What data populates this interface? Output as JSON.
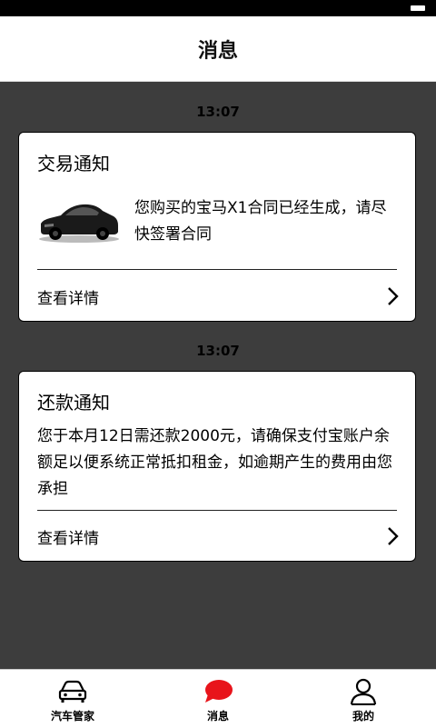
{
  "header": {
    "title": "消息"
  },
  "messages": [
    {
      "time": "13:07",
      "title": "交易通知",
      "body": "您购买的宝马X1合同已经生成，请尽快签署合同",
      "link": "查看详情"
    },
    {
      "time": "13:07",
      "title": "还款通知",
      "body": "您于本月12日需还款2000元，请确保支付宝账户余额足以便系统正常抵扣租金，如逾期产生的费用由您承担",
      "link": "查看详情"
    }
  ],
  "tabs": [
    {
      "label": "汽车管家",
      "icon": "car-icon"
    },
    {
      "label": "消息",
      "icon": "chat-bubble-icon",
      "active": true
    },
    {
      "label": "我的",
      "icon": "person-icon"
    }
  ],
  "colors": {
    "accent": "#e8141b",
    "background": "#3d3d3d"
  }
}
